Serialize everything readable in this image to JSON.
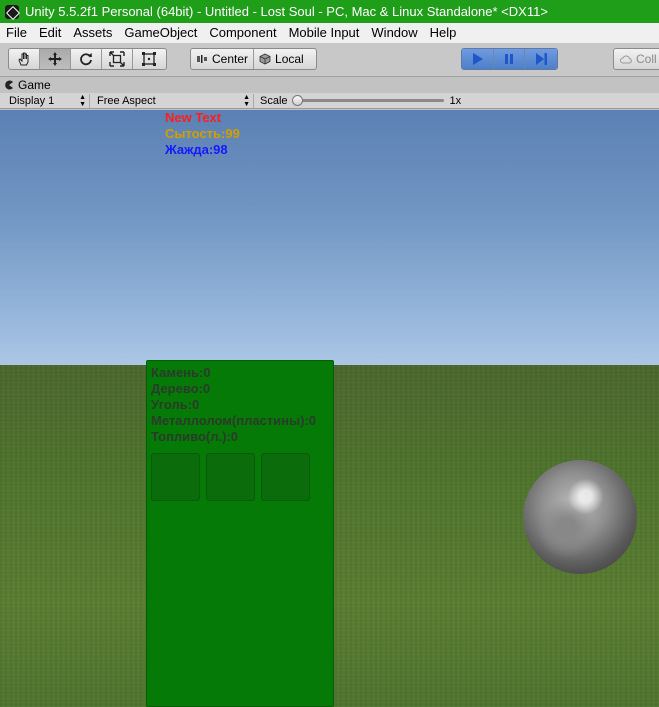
{
  "window": {
    "title": "Unity 5.5.2f1 Personal (64bit) - Untitled - Lost Soul - PC, Mac & Linux Standalone* <DX11>"
  },
  "menu": [
    "File",
    "Edit",
    "Assets",
    "GameObject",
    "Component",
    "Mobile Input",
    "Window",
    "Help"
  ],
  "toolbar": {
    "tools": [
      "hand-icon",
      "move-icon",
      "rotate-icon",
      "scale-icon",
      "rect-icon"
    ],
    "active_tool": "move-icon",
    "pivot_label": "Center",
    "space_label": "Local",
    "play_state": "playing",
    "collab_label": "Coll"
  },
  "game_panel": {
    "tab_label": "Game",
    "display_label": "Display 1",
    "aspect_label": "Free Aspect",
    "scale_label": "Scale",
    "scale_value": "1x"
  },
  "hud": {
    "line1": "New Text",
    "line2": "Сытость:99",
    "line3": "Жажда:98"
  },
  "inventory": {
    "lines": [
      "Камень:0",
      "Дерево:0",
      "Уголь:0",
      "Металлолом(пластины):0",
      "Топливо(л.):0"
    ],
    "slot_count": 3
  },
  "colors": {
    "titlebar": "#1f9e19",
    "hud_line1": "#ff1e1e",
    "hud_line2": "#d1a000",
    "hud_line3": "#1818ff",
    "inventory_bg": "#067a06"
  }
}
